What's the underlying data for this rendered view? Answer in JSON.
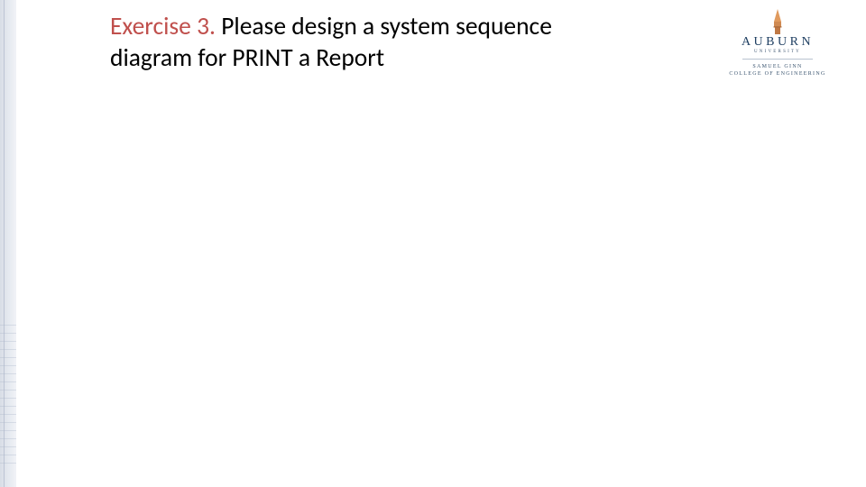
{
  "title": {
    "accent": "Exercise 3. ",
    "rest": "Please design a system sequence diagram for PRINT a Report"
  },
  "logo": {
    "wordmark": "AUBURN",
    "sub": "UNIVERSITY",
    "college_line1": "SAMUEL GINN",
    "college_line2": "COLLEGE OF ENGINEERING"
  }
}
